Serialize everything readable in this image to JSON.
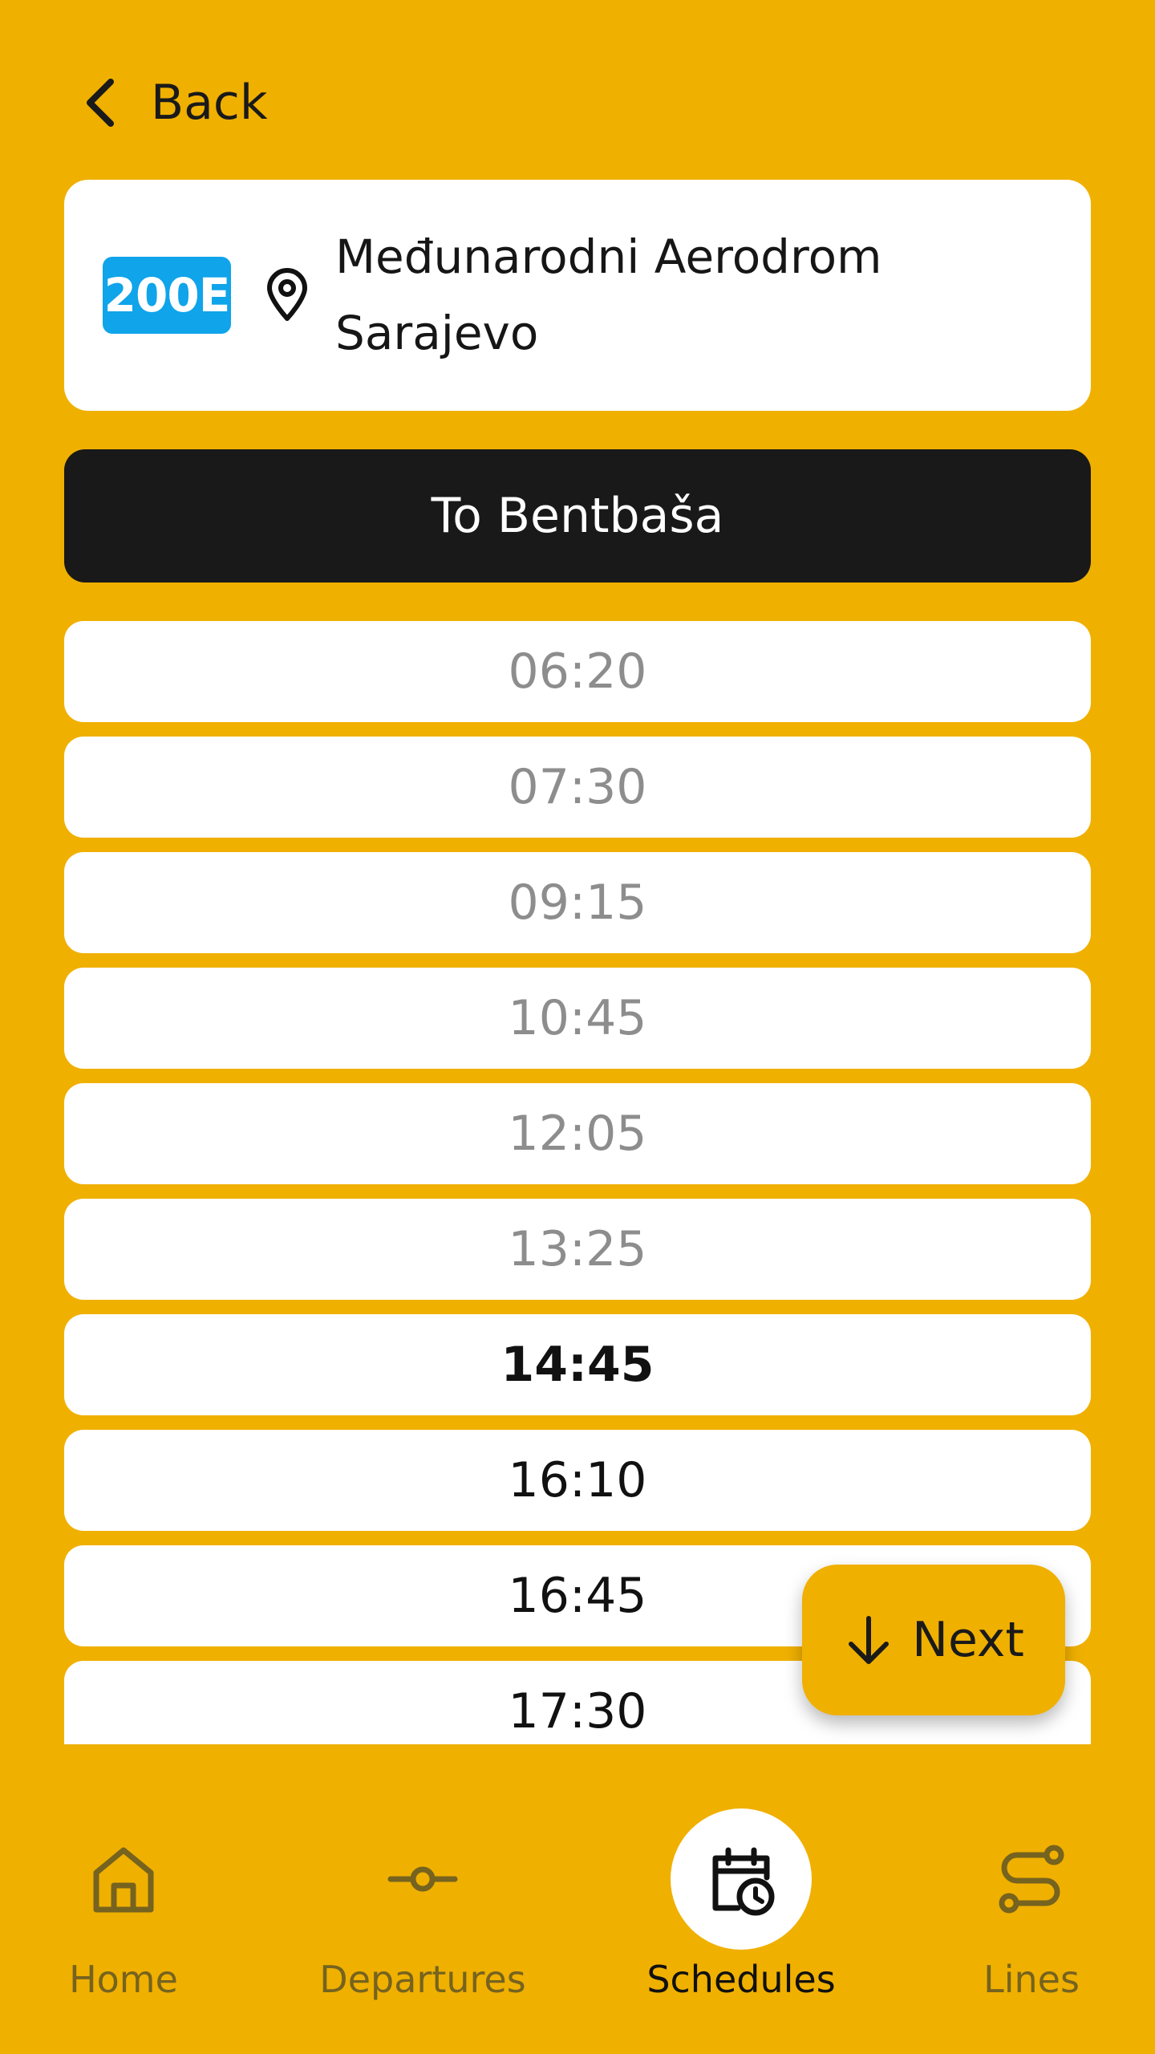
{
  "header": {
    "back_label": "Back"
  },
  "stop": {
    "line_number": "200E",
    "line_color": "#10A4EA",
    "name": "Međunarodni Aerodrom Sarajevo"
  },
  "direction": {
    "label": "To Bentbaša"
  },
  "schedule": {
    "times": [
      {
        "time": "06:20",
        "state": "past"
      },
      {
        "time": "07:30",
        "state": "past"
      },
      {
        "time": "09:15",
        "state": "past"
      },
      {
        "time": "10:45",
        "state": "past"
      },
      {
        "time": "12:05",
        "state": "past"
      },
      {
        "time": "13:25",
        "state": "past"
      },
      {
        "time": "14:45",
        "state": "next"
      },
      {
        "time": "16:10",
        "state": "future"
      },
      {
        "time": "16:45",
        "state": "future"
      },
      {
        "time": "17:30",
        "state": "future"
      }
    ]
  },
  "fab": {
    "label": "Next",
    "icon": "arrow-down-icon"
  },
  "nav": {
    "items": [
      {
        "label": "Home",
        "icon": "home-icon",
        "active": false
      },
      {
        "label": "Departures",
        "icon": "departures-icon",
        "active": false
      },
      {
        "label": "Schedules",
        "icon": "calendar-clock-icon",
        "active": true
      },
      {
        "label": "Lines",
        "icon": "route-icon",
        "active": false
      }
    ]
  },
  "colors": {
    "background": "#F0B000",
    "card": "#FFFFFF",
    "direction_bar": "#191919",
    "past_time": "#8D8D8D"
  }
}
